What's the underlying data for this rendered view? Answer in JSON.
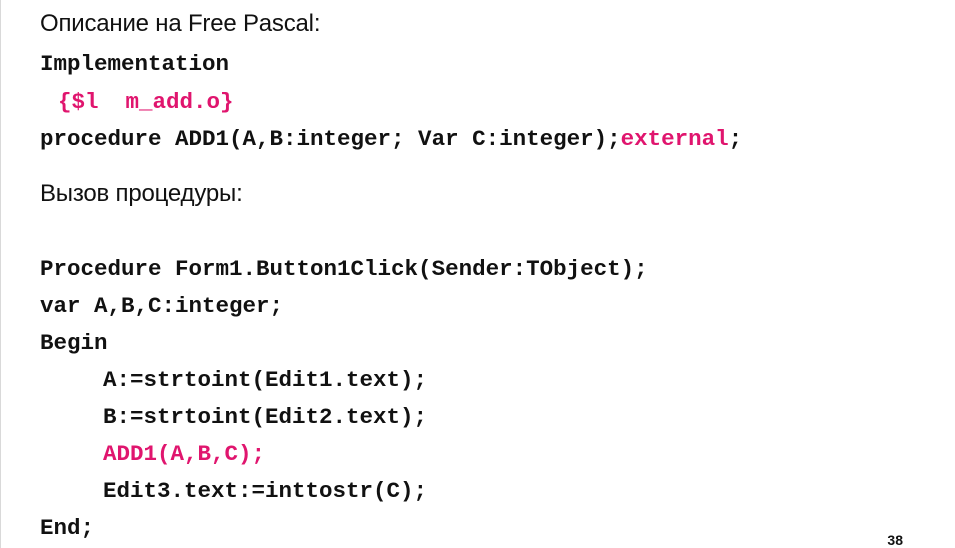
{
  "section1": {
    "heading": "Описание на Free Pascal:",
    "implementation": "Implementation",
    "directive": "{$l  m_add.o}",
    "procedure_decl": "procedure ADD1(A,B:integer; Var C:integer);",
    "external_keyword": "external",
    "semicolon": ";"
  },
  "section2": {
    "heading": "Вызов процедуры:",
    "lines": {
      "proc_header": "Procedure Form1.Button1Click(Sender:TObject);",
      "var_decl": "var A,B,C:integer;",
      "begin": "Begin",
      "assign_a": "A:=strtoint(Edit1.text);",
      "assign_b": "B:=strtoint(Edit2.text);",
      "call_add": "ADD1(A,B,C);",
      "assign_edit3": "Edit3.text:=inttostr(C);",
      "end": "End;"
    }
  },
  "page_number": "38",
  "colors": {
    "highlight": "#e0156e",
    "text": "#111111"
  }
}
